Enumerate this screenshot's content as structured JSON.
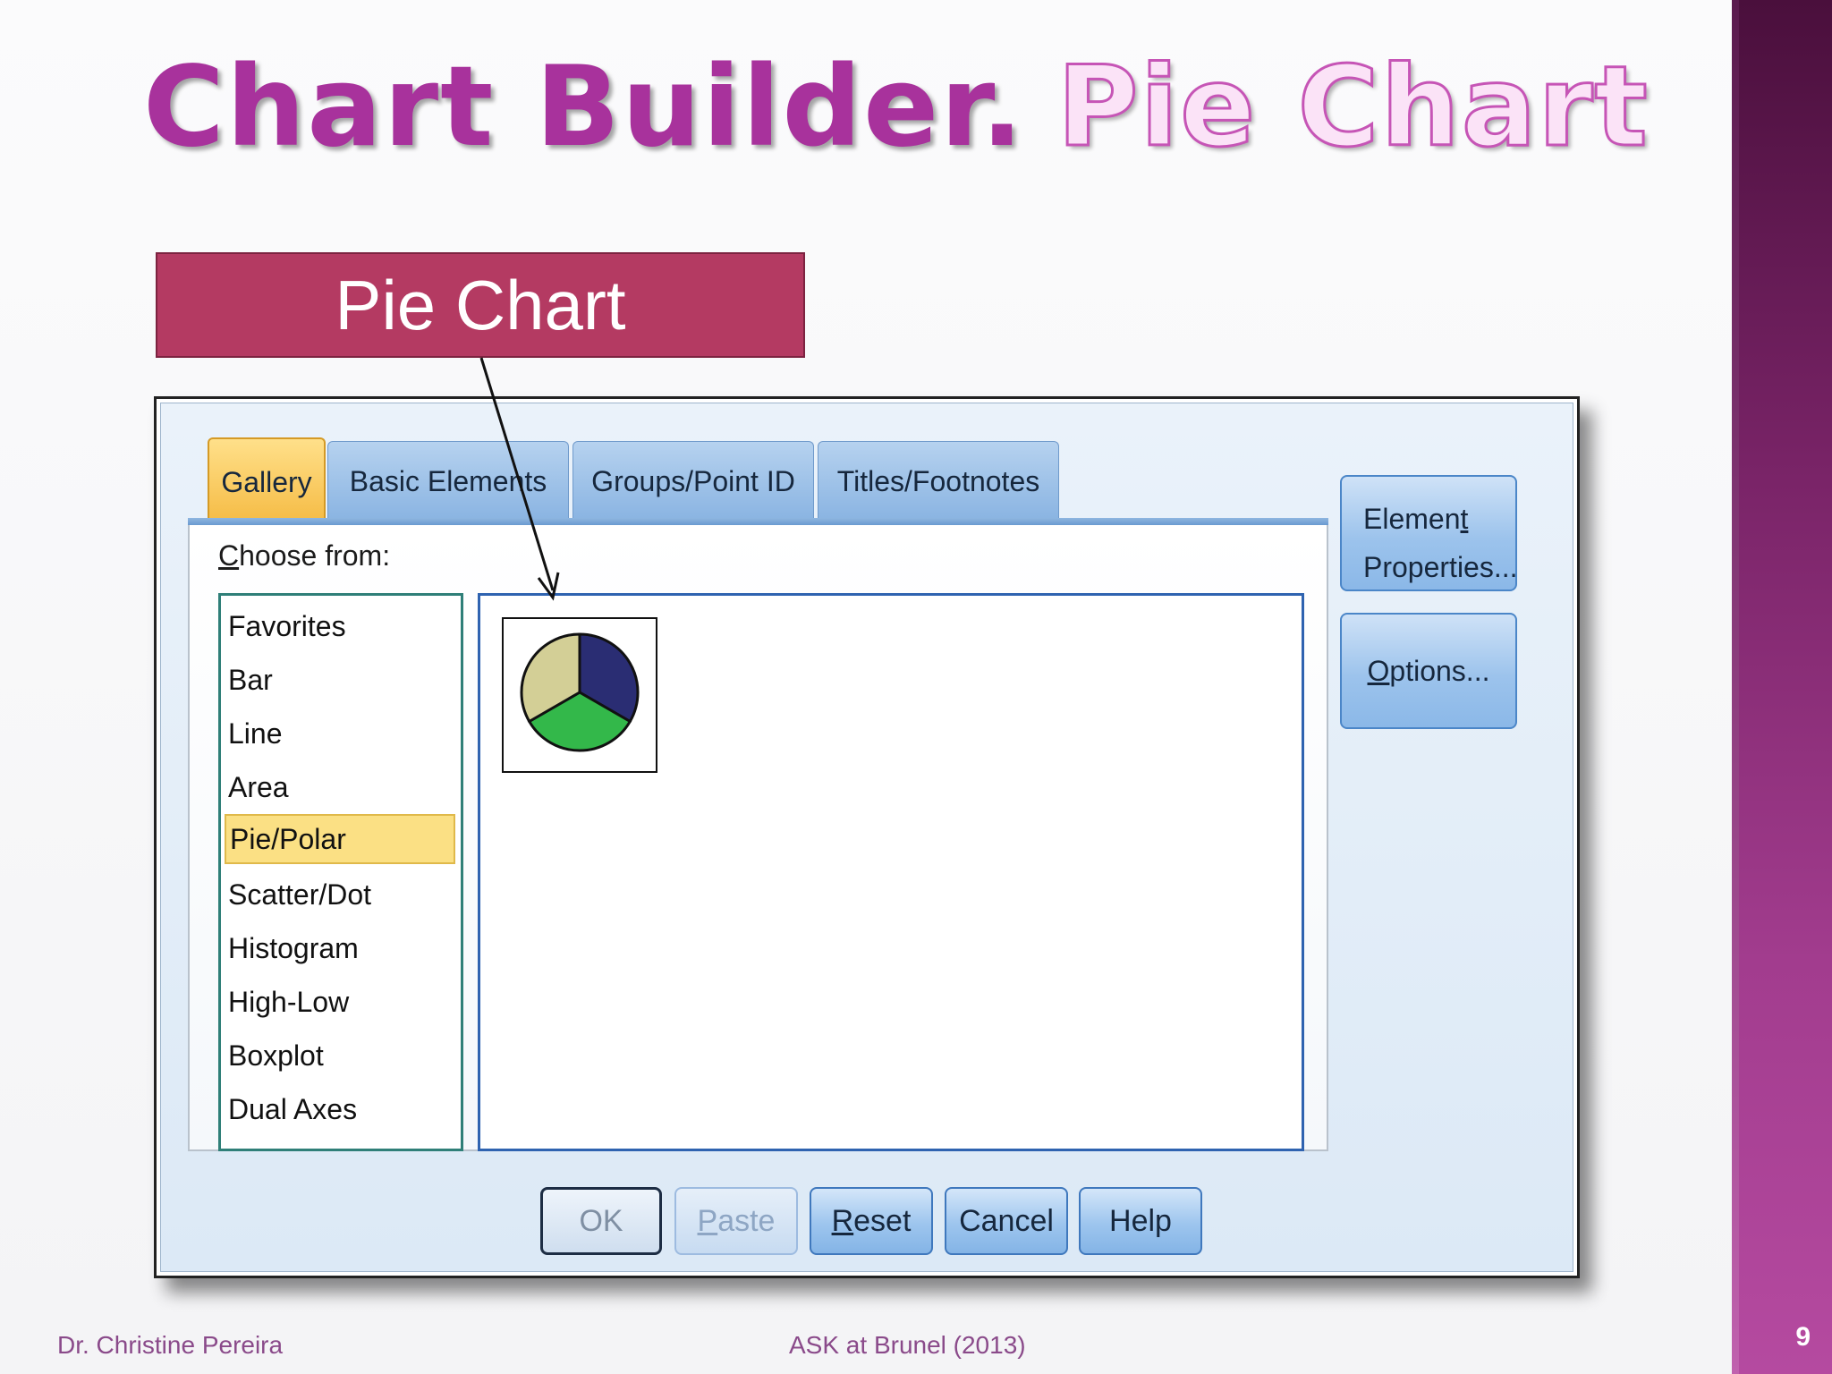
{
  "slide": {
    "title_part1": "Chart Builder.",
    "title_part2": "Pie Chart",
    "callout": "Pie Chart",
    "footer_left": "Dr. Christine Pereira",
    "footer_center": "ASK at Brunel (2013)",
    "page_number": "9"
  },
  "dialog": {
    "tabs": [
      {
        "label": "Gallery",
        "active": true
      },
      {
        "label": "Basic Elements",
        "active": false
      },
      {
        "label": "Groups/Point ID",
        "active": false
      },
      {
        "label": "Titles/Footnotes",
        "active": false
      }
    ],
    "choose_label": {
      "mnemonic": "C",
      "rest": "hoose from:"
    },
    "chart_types": [
      {
        "label": "Favorites",
        "selected": false
      },
      {
        "label": "Bar",
        "selected": false
      },
      {
        "label": "Line",
        "selected": false
      },
      {
        "label": "Area",
        "selected": false
      },
      {
        "label": "Pie/Polar",
        "selected": true
      },
      {
        "label": "Scatter/Dot",
        "selected": false
      },
      {
        "label": "Histogram",
        "selected": false
      },
      {
        "label": "High-Low",
        "selected": false
      },
      {
        "label": "Boxplot",
        "selected": false
      },
      {
        "label": "Dual Axes",
        "selected": false
      }
    ],
    "gallery_item": {
      "icon": "pie-chart-icon",
      "slice_colors": [
        "#2a2d73",
        "#33b84a",
        "#d3cf96"
      ]
    },
    "element_properties": {
      "line1_pre": "Elemen",
      "line1_mn": "t",
      "line2": "Properties..."
    },
    "options": {
      "mnemonic": "O",
      "rest": "ptions..."
    },
    "buttons": {
      "ok": "OK",
      "paste": {
        "mnemonic": "P",
        "rest": "aste"
      },
      "reset": {
        "mnemonic": "R",
        "rest": "eset"
      },
      "cancel": "Cancel",
      "help": "Help"
    }
  },
  "colors": {
    "title_primary": "#a8329c",
    "title_secondary": "#fbe3f7",
    "callout_bg": "#b43a62",
    "active_tab": "#f5bb44",
    "selection": "#fbe084"
  }
}
